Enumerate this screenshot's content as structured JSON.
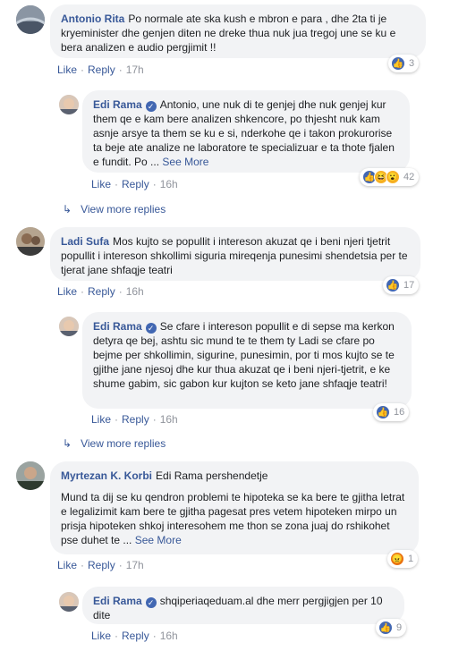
{
  "comments": [
    {
      "author": "Antonio Rita",
      "text": "Po normale ate ska kush e mbron e para , dhe 2ta ti je kryeminister dhe genjen diten ne dreke thua nuk jua tregoj une se ku e bera analizen e audio pergjimit !!",
      "like_label": "Like",
      "reply_label": "Reply",
      "time": "17h",
      "reaction_count": "3",
      "reactions": [
        "like-icon"
      ]
    },
    {
      "author": "Edi Rama",
      "text": "Antonio, une nuk di te genjej dhe nuk genjej kur them qe e kam bere analizen shkencore, po thjesht nuk kam asnje arsye ta them se ku e si, nderkohe qe i takon prokurorise ta beje ate analize ne laboratore te specializuar e ta thote fjalen e fundit. Po ...",
      "see_more": "See More",
      "like_label": "Like",
      "reply_label": "Reply",
      "time": "16h",
      "reaction_count": "42",
      "reactions": [
        "like-icon",
        "haha-icon",
        "wow-icon"
      ]
    },
    {
      "view_more": "View more replies"
    },
    {
      "author": "Ladi Sufa",
      "text": "Mos kujto se popullit i intereson akuzat qe i beni njeri tjetrit popullit i intereson shkollimi siguria mireqenja punesimi shendetsia per te tjerat jane shfaqje teatri",
      "like_label": "Like",
      "reply_label": "Reply",
      "time": "16h",
      "reaction_count": "17",
      "reactions": [
        "like-icon"
      ]
    },
    {
      "author": "Edi Rama",
      "text": "Se cfare i intereson popullit e di sepse ma kerkon detyra qe bej, ashtu sic mund te te them ty Ladi se cfare po bejme per shkollimin, sigurine, punesimin, por ti mos kujto se te gjithe jane njesoj dhe kur thua akuzat qe i beni njeri-tjetrit, e ke shume gabim, sic gabon kur kujton se keto jane shfaqje teatri!",
      "like_label": "Like",
      "reply_label": "Reply",
      "time": "16h",
      "reaction_count": "16",
      "reactions": [
        "like-icon"
      ]
    },
    {
      "view_more": "View more replies"
    },
    {
      "author": "Myrtezan K. Korbi",
      "text": "Edi Rama pershendetje",
      "text2": "Mund ta dij se ku qendron problemi te hipoteka se ka bere te gjitha letrat e legalizimit kam bere te gjitha pagesat pres vetem hipoteken mirpo un prisja hipoteken shkoj interesohem me thon se zona juaj do rshikohet pse duhet te ...",
      "see_more": "See More",
      "like_label": "Like",
      "reply_label": "Reply",
      "time": "17h",
      "reaction_count": "1",
      "reactions": [
        "angry-icon"
      ]
    },
    {
      "author": "Edi Rama",
      "text": "shqiperiaqeduam.al dhe merr pergjigjen per 10 dite",
      "like_label": "Like",
      "reply_label": "Reply",
      "time": "16h",
      "reaction_count": "9",
      "reactions": [
        "like-icon"
      ]
    }
  ],
  "colors": {
    "link": "#385898",
    "bubble": "#f2f3f5",
    "meta": "#90949c",
    "like": "#4267b2"
  }
}
